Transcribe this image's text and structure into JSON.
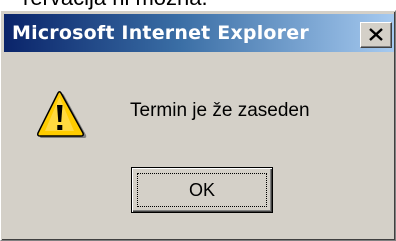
{
  "background": {
    "partial_text": "rervacija ni možna."
  },
  "dialog": {
    "title": "Microsoft Internet Explorer",
    "message": "Termin je že zaseden",
    "icon": "warning-icon",
    "ok_label": "OK",
    "close_icon": "close-icon"
  },
  "colors": {
    "titlebar_start": "#0a246a",
    "titlebar_end": "#a6caf0",
    "face": "#d4d0c8",
    "warning_yellow": "#ffcc00"
  }
}
